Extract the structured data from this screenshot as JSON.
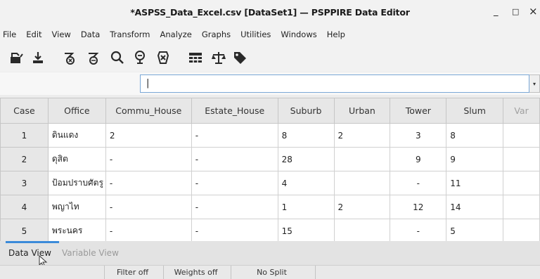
{
  "window": {
    "title": "*ASPSS_Data_Excel.csv [DataSet1] — PSPPIRE Data Editor",
    "minimize": "_",
    "maximize": "□",
    "close": "×"
  },
  "menubar": [
    "File",
    "Edit",
    "View",
    "Data",
    "Transform",
    "Analyze",
    "Graphs",
    "Utilities",
    "Windows",
    "Help"
  ],
  "toolbar": {
    "icons": [
      "open-file-icon",
      "save-icon",
      "goto-case-icon",
      "goto-variable-icon",
      "find-icon",
      "insert-case-icon",
      "delete-variable-icon",
      "split-file-icon",
      "weight-cases-icon",
      "value-labels-icon"
    ]
  },
  "cell_editor": {
    "reference": "",
    "value": "|",
    "dropdown": "▾"
  },
  "grid": {
    "columns": [
      "Case",
      "Office",
      "Commu_House",
      "Estate_House",
      "Suburb",
      "Urban",
      "Tower",
      "Slum",
      "Var"
    ],
    "rows": [
      [
        "1",
        "ดินแดง",
        "2",
        "-",
        "8",
        "2",
        "3",
        "8",
        ""
      ],
      [
        "2",
        "ดุสิต",
        "-",
        "-",
        "28",
        "",
        "9",
        "9",
        ""
      ],
      [
        "3",
        "ป้อมปราบศัตรู",
        "-",
        "-",
        "4",
        "",
        "-",
        "11",
        ""
      ],
      [
        "4",
        "พญาไท",
        "-",
        "-",
        "1",
        "2",
        "12",
        "14",
        ""
      ],
      [
        "5",
        "พระนคร",
        "-",
        "-",
        "15",
        "",
        "-",
        "5",
        ""
      ]
    ]
  },
  "tabs": {
    "active": "Data View",
    "inactive": "Variable View"
  },
  "status": {
    "filter": "Filter off",
    "weights": "Weights off",
    "split": "No Split"
  },
  "colors": {
    "accent": "#3b8ad9",
    "header_bg": "#e7e7e7",
    "grid_border": "#d0d0d0"
  }
}
